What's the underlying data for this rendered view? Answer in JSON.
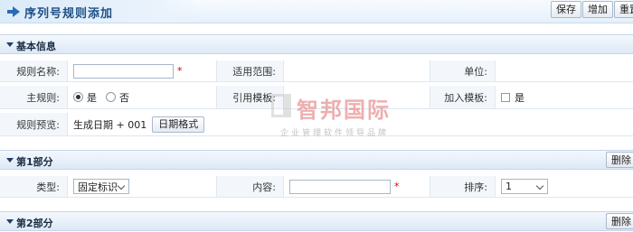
{
  "header": {
    "title": "序列号规则添加",
    "buttons": {
      "save": "保存",
      "add": "增加",
      "reset": "重置"
    }
  },
  "basic": {
    "section_title": "基本信息",
    "rule_name_label": "规则名称:",
    "rule_name_value": "",
    "scope_label": "适用范围:",
    "unit_label": "单位:",
    "main_rule_label": "主规则:",
    "yes": "是",
    "no": "否",
    "main_rule_selected": "是",
    "ref_template_label": "引用模板:",
    "ref_template_value": "",
    "join_template_label": "加入模板:",
    "join_template_option": "是",
    "join_template_checked": false,
    "preview_label": "规则预览:",
    "preview_value": "生成日期 + 001",
    "date_format_button": "日期格式"
  },
  "parts": [
    {
      "title": "第1部分",
      "delete_button": "删除",
      "type_label": "类型:",
      "type_value": "固定标识",
      "content_label": "内容:",
      "content_value": "",
      "order_label": "排序:",
      "order_value": "1"
    },
    {
      "title": "第2部分",
      "delete_button": "删除"
    }
  ],
  "watermark": {
    "brand": "智邦国际",
    "slogan": "企业管理软件领导品牌"
  }
}
